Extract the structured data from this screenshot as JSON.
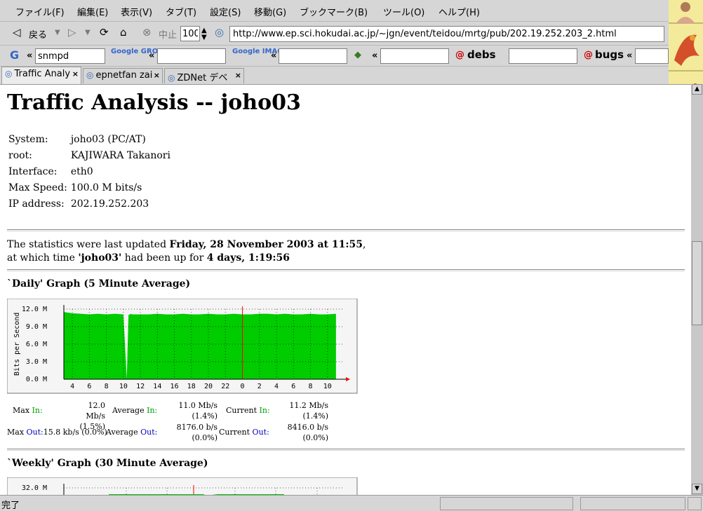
{
  "menu": [
    "ファイル(F)",
    "編集(E)",
    "表示(V)",
    "タブ(T)",
    "設定(S)",
    "移動(G)",
    "ブックマーク(B)",
    "ツール(O)",
    "ヘルプ(H)"
  ],
  "nav": {
    "back_label": "戻る",
    "stop_label": "中止",
    "zoom_value": "100",
    "url": "http://www.ep.sci.hokudai.ac.jp/~jgn/event/teidou/mrtg/pub/202.19.252.203_2.html"
  },
  "search": {
    "google_value": "snmpd",
    "groups_label": "Google GROUPS",
    "images_label": "Google IMAGES",
    "debs_label": "debs",
    "bugs_label": "bugs"
  },
  "tabs": [
    "Traffic Analy",
    "epnetfan zai",
    "ZDNet デベ"
  ],
  "page": {
    "title": "Traffic Analysis -- joho03",
    "info": [
      {
        "label": "System:",
        "value": "joho03 (PC/AT)"
      },
      {
        "label": "root:",
        "value": "KAJIWARA Takanori"
      },
      {
        "label": "Interface:",
        "value": "eth0"
      },
      {
        "label": "Max Speed:",
        "value": "100.0 M bits/s"
      },
      {
        "label": "IP address:",
        "value": "202.19.252.203"
      }
    ],
    "updated_prefix": "The statistics were last updated ",
    "updated_value": "Friday, 28 November 2003 at 11:55",
    "updated_suffix": ",",
    "uptime_prefix": "at which time ",
    "uptime_host": "'joho03'",
    "uptime_mid": " had been up for ",
    "uptime_value": "4 days, 1:19:56",
    "daily_heading": "`Daily' Graph (5 Minute Average)",
    "weekly_heading": "`Weekly' Graph (30 Minute Average)",
    "stats": {
      "max_label": "Max",
      "average_label": "Average",
      "current_label": "Current",
      "in_label": "In:",
      "out_label": "Out:",
      "max_in": "12.0 Mb/s",
      "max_in_pct": "(1.5%)",
      "avg_in": "11.0 Mb/s",
      "avg_in_pct": "(1.4%)",
      "cur_in": "11.2 Mb/s",
      "cur_in_pct": "(1.4%)",
      "max_out": "15.8 kb/s (0.0%)",
      "avg_out": "8176.0 b/s",
      "avg_out_pct": "(0.0%)",
      "cur_out": "8416.0 b/s",
      "cur_out_pct": "(0.0%)"
    }
  },
  "status": "完了",
  "colors": {
    "in": "#00cc00",
    "out": "#0000ff",
    "now_line": "#ff0000"
  },
  "chart_data": [
    {
      "type": "area",
      "title": "",
      "ylabel": "Bits per Second",
      "ylim": [
        0,
        12000000
      ],
      "yticks": [
        "0.0 M",
        "3.0 M",
        "6.0 M",
        "9.0 M",
        "12.0 M"
      ],
      "xticks": [
        "4",
        "6",
        "8",
        "10",
        "12",
        "14",
        "16",
        "18",
        "20",
        "22",
        "0",
        "2",
        "4",
        "6",
        "8",
        "10"
      ],
      "x_hours": [
        3,
        4,
        5,
        6,
        7,
        8,
        9,
        10,
        10.4,
        10.6,
        10.9,
        11,
        12,
        13,
        14,
        15,
        16,
        17,
        18,
        19,
        20,
        21,
        22,
        23,
        24,
        25,
        26,
        27,
        28,
        29,
        30,
        31,
        32,
        33,
        34,
        35
      ],
      "series": [
        {
          "values": [
            11500000,
            11300000,
            11200000,
            11100000,
            11200000,
            11100000,
            11200000,
            11100000,
            100000,
            11000000,
            11200000,
            11100000,
            11100000,
            11100000,
            11200000,
            11100000,
            11100000,
            11200000,
            11100000,
            11100000,
            11200000,
            11100000,
            11100000,
            11200000,
            11100000,
            11100000,
            11200000,
            11200000,
            11100000,
            11200000,
            11100000,
            11100000,
            11200000,
            11100000,
            11100000,
            11200000
          ]
        }
      ]
    },
    {
      "type": "area",
      "title": "",
      "ylim": [
        0,
        32000000
      ],
      "yticks": [
        "32.0 M"
      ],
      "series": []
    }
  ]
}
